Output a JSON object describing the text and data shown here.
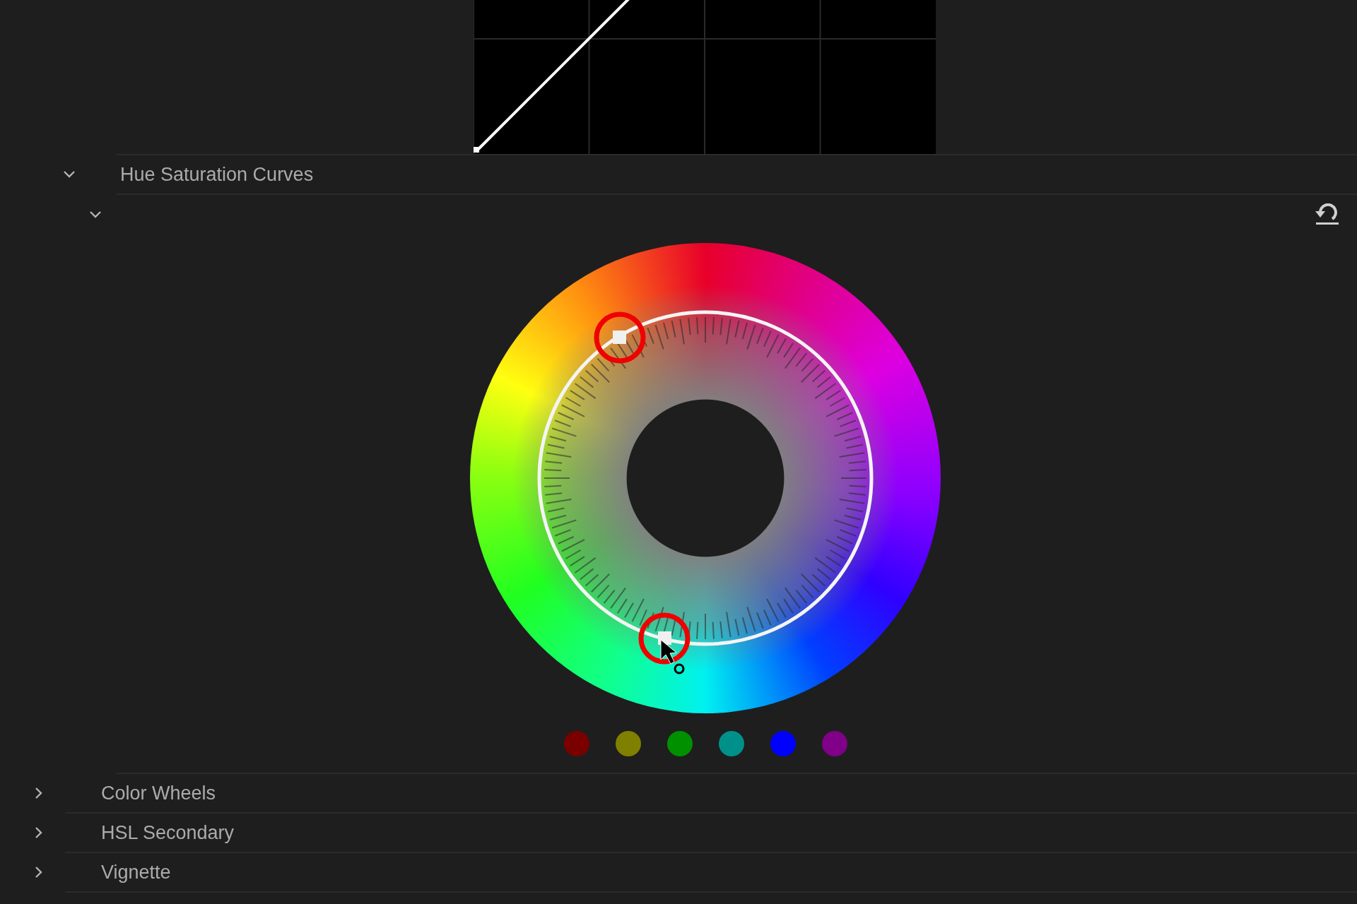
{
  "hue_saturation_curves": {
    "title": "Hue Saturation Curves",
    "expanded": true,
    "subpanel_expanded": true,
    "swatches": [
      {
        "color": "#7a0000"
      },
      {
        "color": "#808000"
      },
      {
        "color": "#009000"
      },
      {
        "color": "#00908a"
      },
      {
        "color": "#0000ff"
      },
      {
        "color": "#800088"
      }
    ]
  },
  "sections": [
    {
      "title": "Color Wheels",
      "expanded": false
    },
    {
      "title": "HSL Secondary",
      "expanded": false
    },
    {
      "title": "Vignette",
      "expanded": false
    }
  ]
}
